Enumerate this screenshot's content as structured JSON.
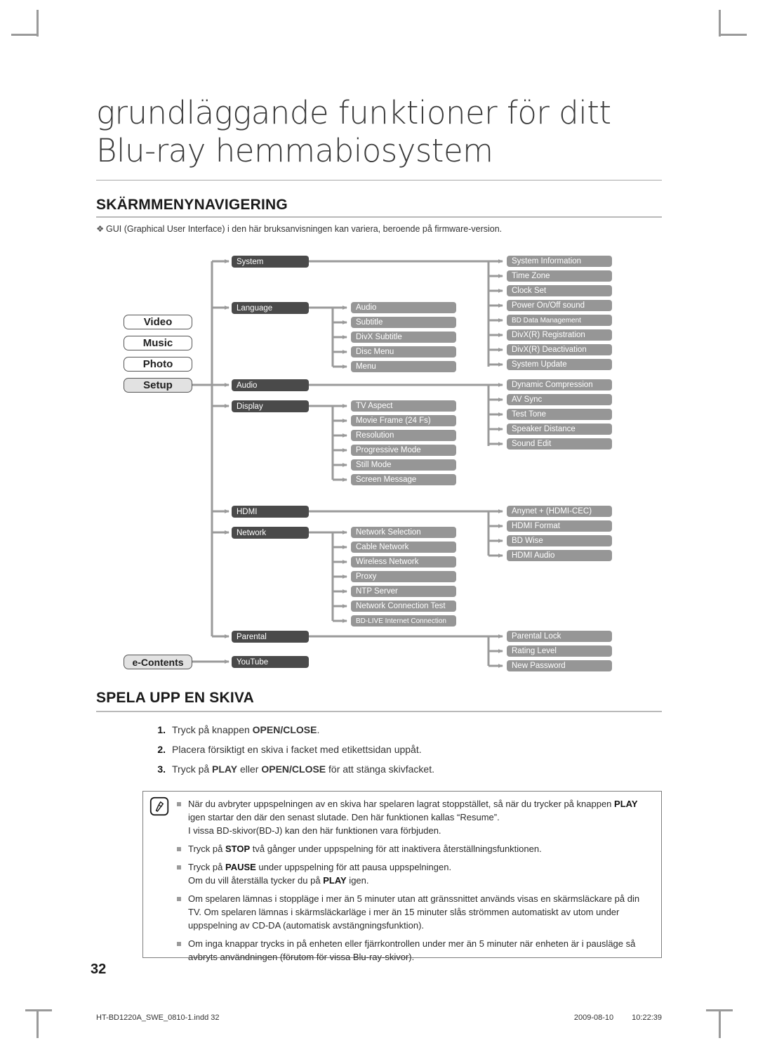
{
  "chapter_title": {
    "line1": "grundläggande funktioner för ditt",
    "line2": "Blu-ray hemmabiosystem"
  },
  "sections": {
    "nav": {
      "heading": "SKÄRMMENYNAVIGERING",
      "bullet": "GUI (Graphical User Interface) i den här bruksanvisningen kan variera, beroende på firmware-version.",
      "bullet_glyph": "❖"
    },
    "play": {
      "heading": "SPELA UPP EN SKIVA"
    }
  },
  "diagram": {
    "root_items": [
      {
        "label": "Video",
        "selected": false
      },
      {
        "label": "Music",
        "selected": false
      },
      {
        "label": "Photo",
        "selected": false
      },
      {
        "label": "Setup",
        "selected": true
      }
    ],
    "econtents_label": "e-Contents",
    "level1": [
      {
        "label": "System"
      },
      {
        "label": "Language"
      },
      {
        "label": "Audio"
      },
      {
        "label": "Display"
      },
      {
        "label": "HDMI"
      },
      {
        "label": "Network"
      },
      {
        "label": "Parental"
      },
      {
        "label": "YouTube"
      }
    ],
    "language_children": [
      "Audio",
      "Subtitle",
      "DivX Subtitle",
      "Disc Menu",
      "Menu"
    ],
    "display_children": [
      "TV Aspect",
      "Movie Frame (24 Fs)",
      "Resolution",
      "Progressive Mode",
      "Still Mode",
      "Screen Message"
    ],
    "network_children": [
      "Network Selection",
      "Cable Network",
      "Wireless Network",
      "Proxy",
      "NTP Server",
      "Network Connection Test",
      "BD-LIVE Internet Connection"
    ],
    "system_children": [
      "System Information",
      "Time Zone",
      "Clock Set",
      "Power On/Off sound",
      "BD Data Management",
      "DivX(R) Registration",
      "DivX(R) Deactivation",
      "System Update"
    ],
    "audio_children": [
      "Dynamic Compression",
      "AV Sync",
      "Test Tone",
      "Speaker Distance",
      "Sound Edit"
    ],
    "hdmi_children": [
      "Anynet + (HDMI-CEC)",
      "HDMI Format",
      "BD Wise",
      "HDMI Audio"
    ],
    "parental_children": [
      "Parental Lock",
      "Rating Level",
      "New Password"
    ],
    "colors": {
      "level1_box": "#4a4a4a",
      "level2_box": "#969696",
      "connector": "#9a9a9a",
      "root_selected": "#e2e2e2"
    }
  },
  "steps": [
    {
      "num": "1.",
      "html": "Tryck på knappen <b>OPEN/CLOSE</b>."
    },
    {
      "num": "2.",
      "html": "Placera försiktigt en skiva i facket med etikettsidan uppåt."
    },
    {
      "num": "3.",
      "html": "Tryck på <b>PLAY</b> eller <b>OPEN/CLOSE</b> för att stänga skivfacket."
    }
  ],
  "notes": [
    {
      "html": "När du avbryter uppspelningen av en skiva har spelaren lagrat stoppstället, så när du trycker på knappen <b>PLAY</b> igen startar den där den senast slutade. Den här funktionen kallas “Resume”.<br>I vissa BD-skivor(BD-J) kan den här funktionen vara förbjuden."
    },
    {
      "html": "Tryck på <b>STOP</b> två gånger under uppspelning för att inaktivera återställningsfunktionen."
    },
    {
      "html": "Tryck på <b>PAUSE</b> under uppspelning för att pausa uppspelningen.<br>Om du vill återställa tycker du på <b>PLAY</b> igen."
    },
    {
      "html": "Om spelaren lämnas i stoppläge i mer än 5 minuter utan att gränssnittet används visas en skärmsläckare på din TV. Om spelaren lämnas i skärmsläckarläge i mer än 15 minuter slås strömmen automatiskt av utom under uppspelning av CD-DA (automatisk avstängningsfunktion)."
    },
    {
      "html": "Om inga knappar trycks in på enheten eller fjärrkontrollen under mer än 5 minuter när enheten är i pausläge så avbryts användningen (förutom för vissa Blu-ray-skivor)."
    }
  ],
  "page_number": "32",
  "footer": {
    "file": "HT-BD1220A_SWE_0810-1.indd   32",
    "date": "2009-08-10",
    "time": "10:22:39"
  }
}
